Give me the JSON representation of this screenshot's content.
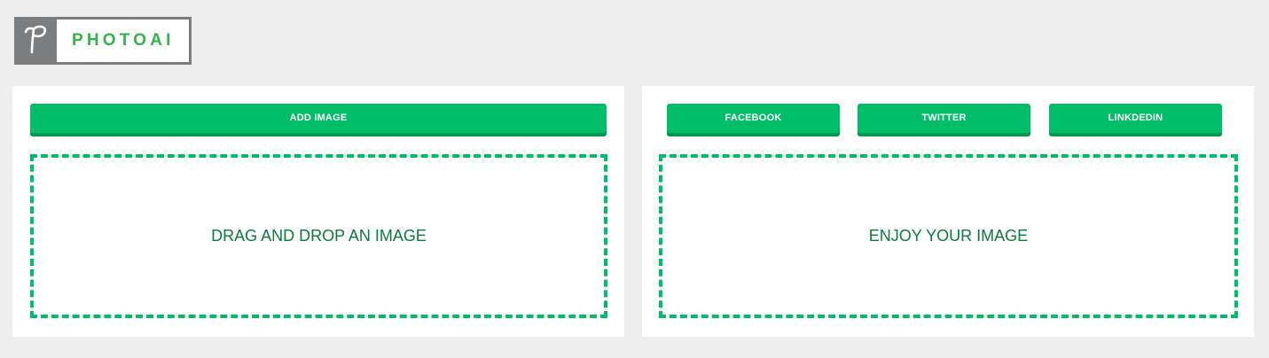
{
  "brand": {
    "logo_letter": "P",
    "name": "PHOTOAI"
  },
  "left_panel": {
    "add_button_label": "ADD IMAGE",
    "dropzone_text": "DRAG AND DROP AN IMAGE"
  },
  "right_panel": {
    "share_buttons": [
      {
        "label": "FACEBOOK"
      },
      {
        "label": "TWITTER"
      },
      {
        "label": "LINKDEDIN"
      }
    ],
    "dropzone_text": "ENJOY YOUR IMAGE"
  },
  "colors": {
    "background": "#eeeeee",
    "accent_green": "#00be68",
    "accent_green_dark": "#009a50",
    "text_green": "#0b7a3e",
    "logo_grey": "#7c7d7f"
  }
}
